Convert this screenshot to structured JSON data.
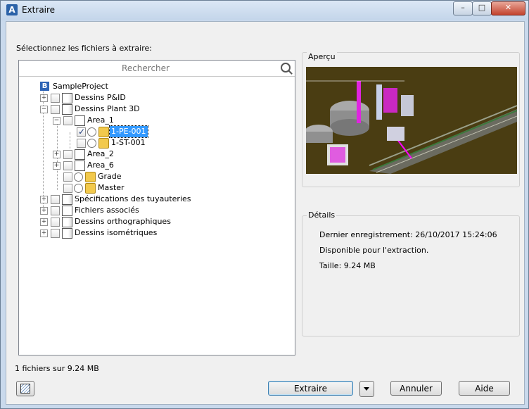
{
  "window": {
    "title": "Extraire",
    "app_icon": "A"
  },
  "prompt": "Sélectionnez les fichiers à extraire:",
  "search": {
    "placeholder": "Rechercher"
  },
  "tree": {
    "root": "SampleProject",
    "items": [
      {
        "label": "Dessins P&ID"
      },
      {
        "label": "Dessins Plant 3D"
      },
      {
        "label": "Area_1"
      },
      {
        "label": "1-PE-001",
        "checked": true,
        "selected": true
      },
      {
        "label": "1-ST-001"
      },
      {
        "label": "Area_2"
      },
      {
        "label": "Area_6"
      },
      {
        "label": "Grade"
      },
      {
        "label": "Master"
      },
      {
        "label": "Spécifications des tuyauteries"
      },
      {
        "label": "Fichiers associés"
      },
      {
        "label": "Dessins orthographiques"
      },
      {
        "label": "Dessins isométriques"
      }
    ]
  },
  "preview": {
    "label": "Aperçu"
  },
  "details": {
    "label": "Détails",
    "last_saved": "Dernier enregistrement: 26/10/2017 15:24:06",
    "availability": "Disponible pour l'extraction.",
    "size": "Taille: 9.24 MB"
  },
  "status": "1 fichiers sur 9.24 MB",
  "buttons": {
    "extract": "Extraire",
    "cancel": "Annuler",
    "help": "Aide"
  },
  "colors": {
    "selection": "#3399ff",
    "preview_bg": "#4a3d12"
  }
}
